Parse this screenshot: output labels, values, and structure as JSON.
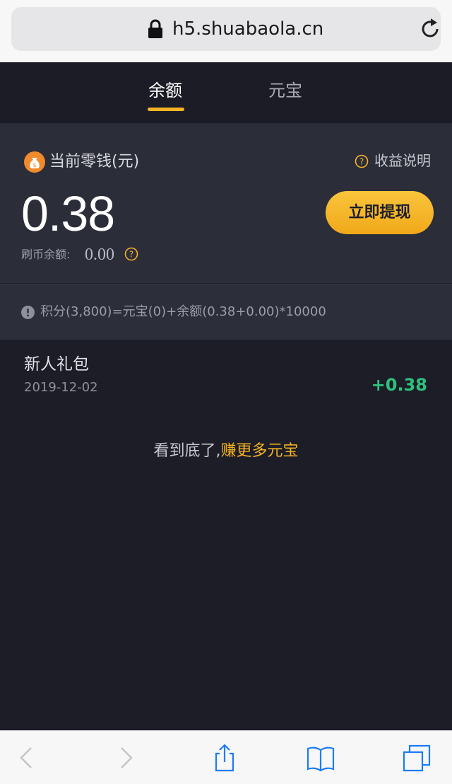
{
  "browser": {
    "url": "h5.shuabaola.cn"
  },
  "tabs": [
    {
      "label": "余额",
      "active": true
    },
    {
      "label": "元宝",
      "active": false
    }
  ],
  "card": {
    "label": "当前零钱(元)",
    "explain_label": "收益说明",
    "amount": "0.38",
    "withdraw_label": "立即提现",
    "coin_label": "刷币余额:",
    "coin_value": "0.00"
  },
  "formula": {
    "text": "积分(3,800)=元宝(0)+余额(0.38+0.00)*10000"
  },
  "records": [
    {
      "title": "新人礼包",
      "date": "2019-12-02",
      "amount": "+0.38"
    }
  ],
  "footer": {
    "end_text": "看到底了,",
    "earn_link": "赚更多元宝"
  },
  "colors": {
    "accent": "#f5b324",
    "positive": "#2fc07d",
    "background": "#1c1d27",
    "card": "#2b2d39"
  },
  "icons": [
    "lock-icon",
    "reload-icon",
    "money-bag-icon",
    "help-circle-icon",
    "alert-icon",
    "back-icon",
    "forward-icon",
    "share-icon",
    "bookmarks-icon",
    "tabs-icon"
  ]
}
